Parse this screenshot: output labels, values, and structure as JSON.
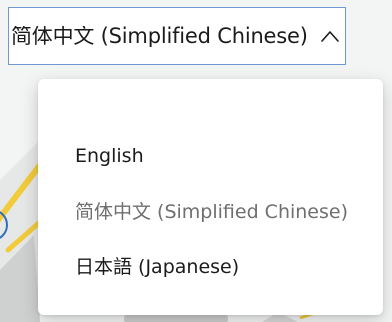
{
  "select": {
    "value": "简体中文 (Simplified Chinese)",
    "state": "expanded",
    "chevron_icon": "chevron-up-icon",
    "border_color": "#6e97d6"
  },
  "menu": {
    "items": [
      {
        "label": "English",
        "selected": false
      },
      {
        "label": "简体中文 (Simplified Chinese)",
        "selected": true
      },
      {
        "label": "日本語 (Japanese)",
        "selected": false
      }
    ]
  },
  "colors": {
    "text_primary": "#1b1b1b",
    "text_selected": "#6f6f6f",
    "background": "#f3f4f4"
  }
}
